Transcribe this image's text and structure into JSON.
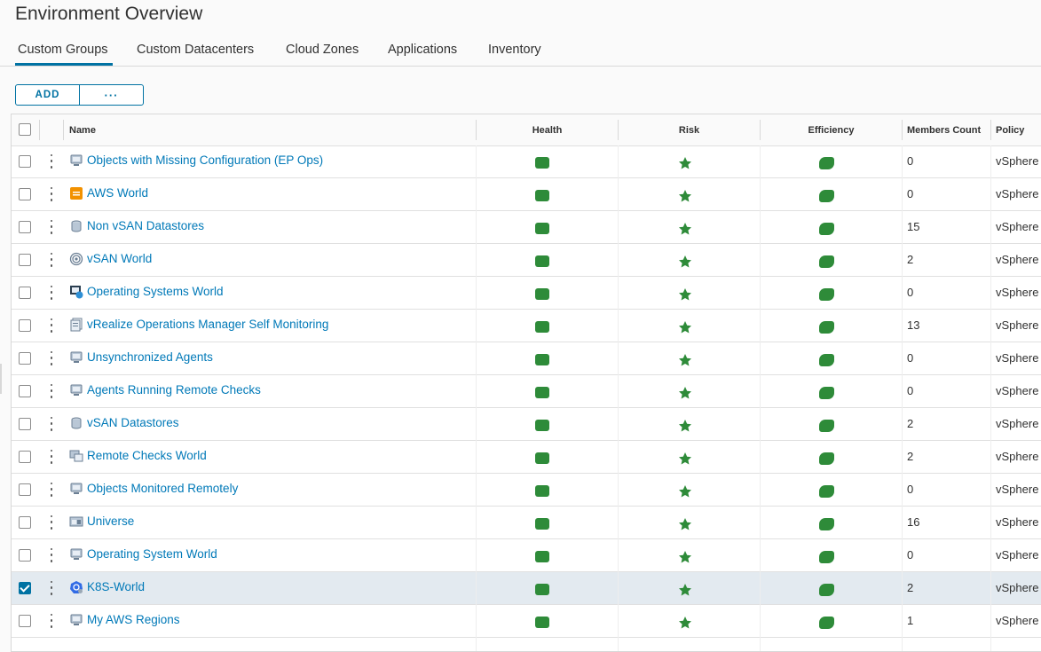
{
  "page": {
    "title": "Environment Overview"
  },
  "tabs": [
    {
      "label": "Custom Groups",
      "active": true
    },
    {
      "label": "Custom Datacenters",
      "active": false
    },
    {
      "label": "Cloud Zones",
      "active": false
    },
    {
      "label": "Applications",
      "active": false
    },
    {
      "label": "Inventory",
      "active": false
    }
  ],
  "toolbar": {
    "add_label": "ADD",
    "more_label": "···"
  },
  "table": {
    "headers": {
      "name": "Name",
      "health": "Health",
      "risk": "Risk",
      "efficiency": "Efficiency",
      "members_count": "Members Count",
      "policy": "Policy"
    },
    "rows": [
      {
        "name": "Objects with Missing Configuration (EP Ops)",
        "icon": "server-group-icon",
        "members": "0",
        "policy": "vSphere",
        "selected": false
      },
      {
        "name": "AWS World",
        "icon": "aws-icon",
        "members": "0",
        "policy": "vSphere",
        "selected": false
      },
      {
        "name": "Non vSAN Datastores",
        "icon": "datastore-icon",
        "members": "15",
        "policy": "vSphere",
        "selected": false
      },
      {
        "name": "vSAN World",
        "icon": "vsan-icon",
        "members": "2",
        "policy": "vSphere",
        "selected": false
      },
      {
        "name": "Operating Systems World",
        "icon": "os-world-icon",
        "members": "0",
        "policy": "vSphere",
        "selected": false
      },
      {
        "name": "vRealize Operations Manager Self Monitoring",
        "icon": "self-monitoring-icon",
        "members": "13",
        "policy": "vSphere",
        "selected": false
      },
      {
        "name": "Unsynchronized Agents",
        "icon": "server-group-icon",
        "members": "0",
        "policy": "vSphere",
        "selected": false
      },
      {
        "name": "Agents Running Remote Checks",
        "icon": "server-group-icon",
        "members": "0",
        "policy": "vSphere",
        "selected": false
      },
      {
        "name": "vSAN Datastores",
        "icon": "datastore-icon",
        "members": "2",
        "policy": "vSphere",
        "selected": false
      },
      {
        "name": "Remote Checks World",
        "icon": "remote-checks-icon",
        "members": "2",
        "policy": "vSphere",
        "selected": false
      },
      {
        "name": "Objects Monitored Remotely",
        "icon": "server-group-icon",
        "members": "0",
        "policy": "vSphere",
        "selected": false
      },
      {
        "name": "Universe",
        "icon": "universe-icon",
        "members": "16",
        "policy": "vSphere",
        "selected": false
      },
      {
        "name": "Operating System World",
        "icon": "server-group-icon",
        "members": "0",
        "policy": "vSphere",
        "selected": false
      },
      {
        "name": "K8S-World",
        "icon": "kubernetes-icon",
        "members": "2",
        "policy": "vSphere",
        "selected": true
      },
      {
        "name": "My AWS Regions",
        "icon": "server-group-icon",
        "members": "1",
        "policy": "vSphere",
        "selected": false
      }
    ]
  },
  "colors": {
    "accent": "#0072a3",
    "link": "#0079b8",
    "status_good": "#2e8b39"
  }
}
